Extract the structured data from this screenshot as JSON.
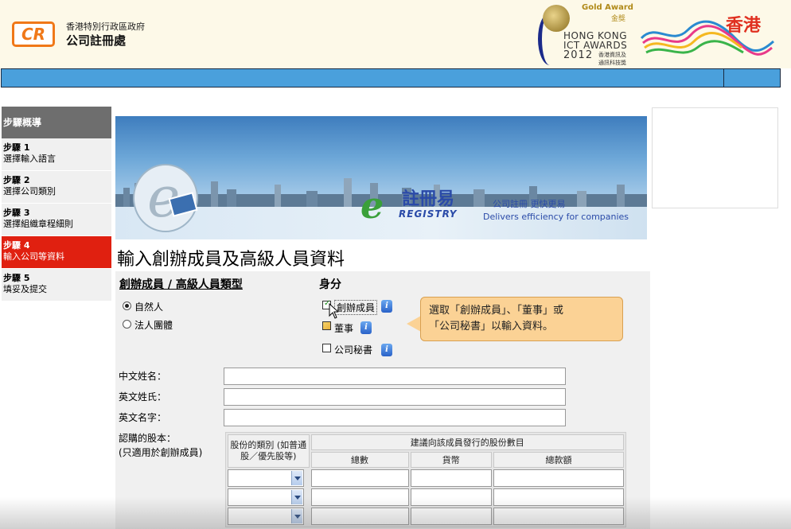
{
  "header": {
    "logo_text": "CR",
    "gov_name": "香港特別行政區政府",
    "org_name": "公司註冊處",
    "award": {
      "gold": "Gold Award",
      "gold_cn": "金獎",
      "line1": "HONG KONG",
      "line2": "ICT AWARDS",
      "year": "2012",
      "cn1": "香港資訊及",
      "cn2": "通訊科技獎"
    },
    "brand_hk": "香港"
  },
  "sidebar": {
    "title": "步驟概導",
    "items": [
      {
        "step": "步驟 1",
        "label": "選擇輸入語言",
        "active": false
      },
      {
        "step": "步驟 2",
        "label": "選擇公司類別",
        "active": false
      },
      {
        "step": "步驟 3",
        "label": "選擇組織章程細則",
        "active": false
      },
      {
        "step": "步驟 4",
        "label": "輸入公司等資料",
        "active": true
      },
      {
        "step": "步驟 5",
        "label": "填妥及提交",
        "active": false
      }
    ]
  },
  "banner": {
    "registry_cn": "註冊易",
    "registry_en": "REGISTRY",
    "tagline_cn": "公司註冊 更快更易",
    "tagline_en": "Delivers efficiency for companies"
  },
  "page_title": "輸入創辦成員及高級人員資料",
  "form": {
    "type_heading": "創辦成員 / 高級人員類型",
    "role_heading": "身分",
    "type_options": [
      {
        "label": "自然人",
        "selected": true
      },
      {
        "label": "法人團體",
        "selected": false
      }
    ],
    "roles": [
      {
        "label": "創辦成員",
        "checked": true
      },
      {
        "label": "董事",
        "checked": false
      },
      {
        "label": "公司秘書",
        "checked": false
      }
    ],
    "info_glyph": "i",
    "tooltip_line1": "選取「創辦成員」、「董事」或",
    "tooltip_line2": "「公司秘書」以輸入資料。",
    "fields": {
      "chinese_name": "中文姓名：",
      "english_surname": "英文姓氏：",
      "english_given": "英文名字："
    },
    "share_label_1": "認購的股本：",
    "share_label_2": "(只適用於創辦成員)",
    "share_table": {
      "class_header": "股份的類別 (如普通股／優先股等)",
      "proposed_header": "建議向該成員發行的股份數目",
      "cols": [
        "總數",
        "貨幣",
        "總款額"
      ]
    }
  },
  "colors": {
    "accent_orange": "#f07818",
    "bluebar": "#4aa0dc",
    "active_step": "#e02010",
    "tooltip_bg": "#fbd295"
  }
}
